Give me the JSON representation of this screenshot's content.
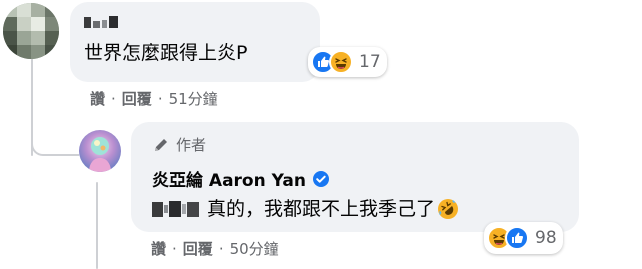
{
  "comment_1": {
    "text": "世界怎麼跟得上炎P",
    "reactions": {
      "icons": [
        "like-icon",
        "haha-icon"
      ],
      "count": "17"
    },
    "actions": {
      "like": "讚",
      "reply": "回覆",
      "separator": "·",
      "timestamp": "51分鐘"
    }
  },
  "comment_2": {
    "badge_label": "作者",
    "author_name": "炎亞綸 Aaron Yan",
    "verified_icon": "verified-badge-icon",
    "text": "真的，我都跟不上我季己了",
    "inline_emoji": "rolling-laughing-icon",
    "reactions": {
      "icons": [
        "haha-icon",
        "like-icon"
      ],
      "count": "98"
    },
    "actions": {
      "like": "讚",
      "reply": "回覆",
      "separator": "·",
      "timestamp": "50分鐘"
    }
  },
  "colors": {
    "bubble_bg": "#f0f2f5",
    "secondary_text": "#65676b",
    "like_blue": "#1877f2",
    "haha_yellow": "#f7b125"
  }
}
